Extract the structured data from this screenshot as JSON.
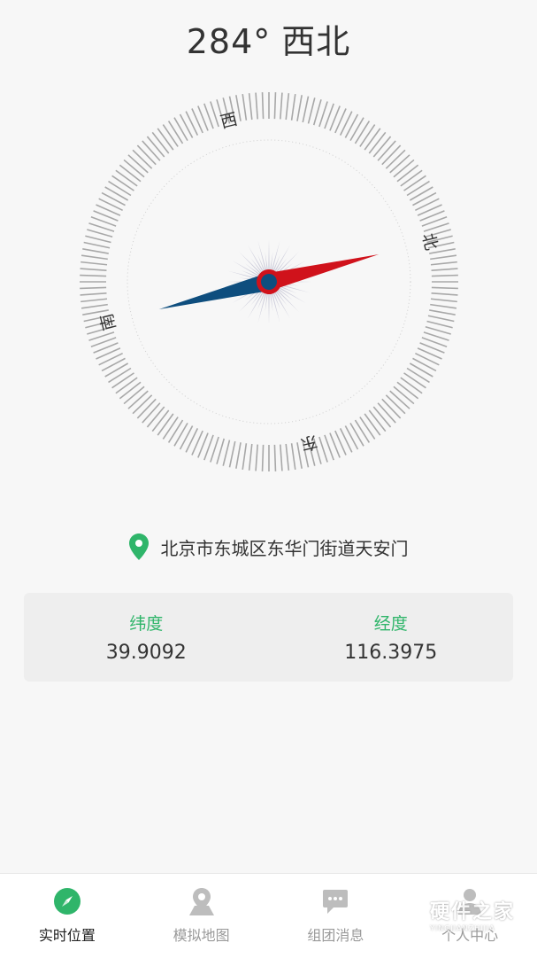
{
  "header": {
    "degree": "284°",
    "direction": "西北"
  },
  "compass": {
    "heading_degrees": 284,
    "labels": {
      "north": "北",
      "east": "东",
      "south": "南",
      "west": "西"
    },
    "needle_colors": {
      "north": "#d0121b",
      "south": "#0e4e7e"
    }
  },
  "location": {
    "icon": "map-pin-icon",
    "address": "北京市东城区东华门街道天安门"
  },
  "coords": {
    "latitude_label": "纬度",
    "latitude_value": "39.9092",
    "longitude_label": "经度",
    "longitude_value": "116.3975"
  },
  "tabbar": {
    "items": [
      {
        "label": "实时位置",
        "icon": "compass-icon",
        "active": true
      },
      {
        "label": "模拟地图",
        "icon": "map-marker-icon",
        "active": false
      },
      {
        "label": "组团消息",
        "icon": "chat-icon",
        "active": false
      },
      {
        "label": "个人中心",
        "icon": "person-icon",
        "active": false
      }
    ]
  },
  "watermark": {
    "text": "硬件之家",
    "subtext": "YINGJIANZHIJIA"
  },
  "colors": {
    "accent": "#2fb56a",
    "text": "#333333",
    "muted": "#9a9a9a"
  }
}
